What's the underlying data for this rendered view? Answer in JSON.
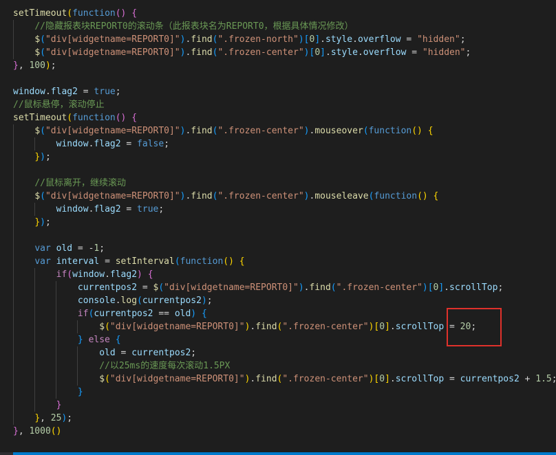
{
  "editor": {
    "language": "javascript",
    "highlight_color": "#e0312b",
    "status_color": "#007acc",
    "lines": [
      [
        [
          "fn",
          "setTimeout"
        ],
        [
          "br",
          "("
        ],
        [
          "kw",
          "function"
        ],
        [
          "br2",
          "()"
        ],
        [
          "op",
          " "
        ],
        [
          "br2",
          "{"
        ]
      ],
      [
        [
          "op",
          "    "
        ],
        [
          "com",
          "//隐藏报表块REPORT0的滚动条（此报表块名为REPORT0，根据具体情况修改）"
        ]
      ],
      [
        [
          "op",
          "    "
        ],
        [
          "fn",
          "$"
        ],
        [
          "br3",
          "("
        ],
        [
          "str",
          "\"div[widgetname=REPORT0]\""
        ],
        [
          "br3",
          ")"
        ],
        [
          "op",
          "."
        ],
        [
          "fn",
          "find"
        ],
        [
          "br3",
          "("
        ],
        [
          "str",
          "\".frozen-north\""
        ],
        [
          "br3",
          ")"
        ],
        [
          "br3",
          "["
        ],
        [
          "num",
          "0"
        ],
        [
          "br3",
          "]"
        ],
        [
          "op",
          "."
        ],
        [
          "var",
          "style"
        ],
        [
          "op",
          "."
        ],
        [
          "var",
          "overflow"
        ],
        [
          "op",
          " = "
        ],
        [
          "str",
          "\"hidden\""
        ],
        [
          "op",
          ";"
        ]
      ],
      [
        [
          "op",
          "    "
        ],
        [
          "fn",
          "$"
        ],
        [
          "br3",
          "("
        ],
        [
          "str",
          "\"div[widgetname=REPORT0]\""
        ],
        [
          "br3",
          ")"
        ],
        [
          "op",
          "."
        ],
        [
          "fn",
          "find"
        ],
        [
          "br3",
          "("
        ],
        [
          "str",
          "\".frozen-center\""
        ],
        [
          "br3",
          ")"
        ],
        [
          "br3",
          "["
        ],
        [
          "num",
          "0"
        ],
        [
          "br3",
          "]"
        ],
        [
          "op",
          "."
        ],
        [
          "var",
          "style"
        ],
        [
          "op",
          "."
        ],
        [
          "var",
          "overflow"
        ],
        [
          "op",
          " = "
        ],
        [
          "str",
          "\"hidden\""
        ],
        [
          "op",
          ";"
        ]
      ],
      [
        [
          "br2",
          "}"
        ],
        [
          "op",
          ", "
        ],
        [
          "num",
          "100"
        ],
        [
          "br",
          ")"
        ],
        [
          "op",
          ";"
        ]
      ],
      [],
      [
        [
          "var",
          "window"
        ],
        [
          "op",
          "."
        ],
        [
          "var",
          "flag2"
        ],
        [
          "op",
          " = "
        ],
        [
          "kw",
          "true"
        ],
        [
          "op",
          ";"
        ]
      ],
      [
        [
          "com",
          "//鼠标悬停，滚动停止"
        ]
      ],
      [
        [
          "fn",
          "setTimeout"
        ],
        [
          "br",
          "("
        ],
        [
          "kw",
          "function"
        ],
        [
          "br2",
          "()"
        ],
        [
          "op",
          " "
        ],
        [
          "br2",
          "{"
        ]
      ],
      [
        [
          "op",
          "    "
        ],
        [
          "fn",
          "$"
        ],
        [
          "br3",
          "("
        ],
        [
          "str",
          "\"div[widgetname=REPORT0]\""
        ],
        [
          "br3",
          ")"
        ],
        [
          "op",
          "."
        ],
        [
          "fn",
          "find"
        ],
        [
          "br3",
          "("
        ],
        [
          "str",
          "\".frozen-center\""
        ],
        [
          "br3",
          ")"
        ],
        [
          "op",
          "."
        ],
        [
          "fn",
          "mouseover"
        ],
        [
          "br3",
          "("
        ],
        [
          "kw",
          "function"
        ],
        [
          "br",
          "()"
        ],
        [
          "op",
          " "
        ],
        [
          "br",
          "{"
        ]
      ],
      [
        [
          "op",
          "        "
        ],
        [
          "var",
          "window"
        ],
        [
          "op",
          "."
        ],
        [
          "var",
          "flag2"
        ],
        [
          "op",
          " = "
        ],
        [
          "kw",
          "false"
        ],
        [
          "op",
          ";"
        ]
      ],
      [
        [
          "op",
          "    "
        ],
        [
          "br",
          "}"
        ],
        [
          "br3",
          ")"
        ],
        [
          "op",
          ";"
        ]
      ],
      [],
      [
        [
          "op",
          "    "
        ],
        [
          "com",
          "//鼠标离开，继续滚动"
        ]
      ],
      [
        [
          "op",
          "    "
        ],
        [
          "fn",
          "$"
        ],
        [
          "br3",
          "("
        ],
        [
          "str",
          "\"div[widgetname=REPORT0]\""
        ],
        [
          "br3",
          ")"
        ],
        [
          "op",
          "."
        ],
        [
          "fn",
          "find"
        ],
        [
          "br3",
          "("
        ],
        [
          "str",
          "\".frozen-center\""
        ],
        [
          "br3",
          ")"
        ],
        [
          "op",
          "."
        ],
        [
          "fn",
          "mouseleave"
        ],
        [
          "br3",
          "("
        ],
        [
          "kw",
          "function"
        ],
        [
          "br",
          "()"
        ],
        [
          "op",
          " "
        ],
        [
          "br",
          "{"
        ]
      ],
      [
        [
          "op",
          "        "
        ],
        [
          "var",
          "window"
        ],
        [
          "op",
          "."
        ],
        [
          "var",
          "flag2"
        ],
        [
          "op",
          " = "
        ],
        [
          "kw",
          "true"
        ],
        [
          "op",
          ";"
        ]
      ],
      [
        [
          "op",
          "    "
        ],
        [
          "br",
          "}"
        ],
        [
          "br3",
          ")"
        ],
        [
          "op",
          ";"
        ]
      ],
      [],
      [
        [
          "op",
          "    "
        ],
        [
          "kw",
          "var"
        ],
        [
          "op",
          " "
        ],
        [
          "var",
          "old"
        ],
        [
          "op",
          " = -"
        ],
        [
          "num",
          "1"
        ],
        [
          "op",
          ";"
        ]
      ],
      [
        [
          "op",
          "    "
        ],
        [
          "kw",
          "var"
        ],
        [
          "op",
          " "
        ],
        [
          "var",
          "interval"
        ],
        [
          "op",
          " = "
        ],
        [
          "fn",
          "setInterval"
        ],
        [
          "br3",
          "("
        ],
        [
          "kw",
          "function"
        ],
        [
          "br",
          "()"
        ],
        [
          "op",
          " "
        ],
        [
          "br",
          "{"
        ]
      ],
      [
        [
          "op",
          "        "
        ],
        [
          "ctl",
          "if"
        ],
        [
          "br2",
          "("
        ],
        [
          "var",
          "window"
        ],
        [
          "op",
          "."
        ],
        [
          "var",
          "flag2"
        ],
        [
          "br2",
          ")"
        ],
        [
          "op",
          " "
        ],
        [
          "br2",
          "{"
        ]
      ],
      [
        [
          "op",
          "            "
        ],
        [
          "var",
          "currentpos2"
        ],
        [
          "op",
          " = "
        ],
        [
          "fn",
          "$"
        ],
        [
          "br3",
          "("
        ],
        [
          "str",
          "\"div[widgetname=REPORT0]\""
        ],
        [
          "br3",
          ")"
        ],
        [
          "op",
          "."
        ],
        [
          "fn",
          "find"
        ],
        [
          "br3",
          "("
        ],
        [
          "str",
          "\".frozen-center\""
        ],
        [
          "br3",
          ")"
        ],
        [
          "br3",
          "["
        ],
        [
          "num",
          "0"
        ],
        [
          "br3",
          "]"
        ],
        [
          "op",
          "."
        ],
        [
          "var",
          "scrollTop"
        ],
        [
          "op",
          ";"
        ]
      ],
      [
        [
          "op",
          "            "
        ],
        [
          "var",
          "console"
        ],
        [
          "op",
          "."
        ],
        [
          "fn",
          "log"
        ],
        [
          "br3",
          "("
        ],
        [
          "var",
          "currentpos2"
        ],
        [
          "br3",
          ")"
        ],
        [
          "op",
          ";"
        ]
      ],
      [
        [
          "op",
          "            "
        ],
        [
          "ctl",
          "if"
        ],
        [
          "br3",
          "("
        ],
        [
          "var",
          "currentpos2"
        ],
        [
          "op",
          " == "
        ],
        [
          "var",
          "old"
        ],
        [
          "br3",
          ")"
        ],
        [
          "op",
          " "
        ],
        [
          "br3",
          "{"
        ]
      ],
      [
        [
          "op",
          "                "
        ],
        [
          "fn",
          "$"
        ],
        [
          "br",
          "("
        ],
        [
          "str",
          "\"div[widgetname=REPORT0]\""
        ],
        [
          "br",
          ")"
        ],
        [
          "op",
          "."
        ],
        [
          "fn",
          "find"
        ],
        [
          "br",
          "("
        ],
        [
          "str",
          "\".frozen-center\""
        ],
        [
          "br",
          ")"
        ],
        [
          "br",
          "["
        ],
        [
          "num",
          "0"
        ],
        [
          "br",
          "]"
        ],
        [
          "op",
          "."
        ],
        [
          "var",
          "scrollTop"
        ],
        [
          "op",
          " = "
        ],
        [
          "num",
          "20"
        ],
        [
          "op",
          ";"
        ]
      ],
      [
        [
          "op",
          "            "
        ],
        [
          "br3",
          "}"
        ],
        [
          "op",
          " "
        ],
        [
          "ctl",
          "else"
        ],
        [
          "op",
          " "
        ],
        [
          "br3",
          "{"
        ]
      ],
      [
        [
          "op",
          "                "
        ],
        [
          "var",
          "old"
        ],
        [
          "op",
          " = "
        ],
        [
          "var",
          "currentpos2"
        ],
        [
          "op",
          ";"
        ]
      ],
      [
        [
          "op",
          "                "
        ],
        [
          "com",
          "//以25ms的速度每次滚动1.5PX"
        ]
      ],
      [
        [
          "op",
          "                "
        ],
        [
          "fn",
          "$"
        ],
        [
          "br",
          "("
        ],
        [
          "str",
          "\"div[widgetname=REPORT0]\""
        ],
        [
          "br",
          ")"
        ],
        [
          "op",
          "."
        ],
        [
          "fn",
          "find"
        ],
        [
          "br",
          "("
        ],
        [
          "str",
          "\".frozen-center\""
        ],
        [
          "br",
          ")"
        ],
        [
          "br",
          "["
        ],
        [
          "num",
          "0"
        ],
        [
          "br",
          "]"
        ],
        [
          "op",
          "."
        ],
        [
          "var",
          "scrollTop"
        ],
        [
          "op",
          " = "
        ],
        [
          "var",
          "currentpos2"
        ],
        [
          "op",
          " + "
        ],
        [
          "num",
          "1.5"
        ],
        [
          "op",
          ";"
        ]
      ],
      [
        [
          "op",
          "            "
        ],
        [
          "br3",
          "}"
        ]
      ],
      [
        [
          "op",
          "        "
        ],
        [
          "br2",
          "}"
        ]
      ],
      [
        [
          "op",
          "    "
        ],
        [
          "br",
          "}"
        ],
        [
          "op",
          ", "
        ],
        [
          "num",
          "25"
        ],
        [
          "br3",
          ")"
        ],
        [
          "op",
          ";"
        ]
      ],
      [
        [
          "br2",
          "}"
        ],
        [
          "op",
          ", "
        ],
        [
          "num",
          "1000"
        ],
        [
          "br",
          "()"
        ]
      ]
    ]
  }
}
